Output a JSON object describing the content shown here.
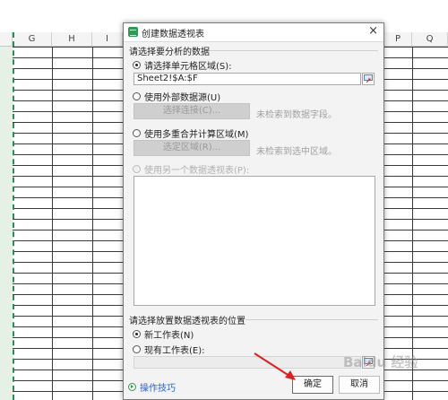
{
  "spreadsheet": {
    "columns": [
      "G",
      "H",
      "I",
      "P",
      "Q"
    ]
  },
  "dialog": {
    "title": "创建数据透视表",
    "close_symbol": "×",
    "section_data_label": "请选择要分析的数据",
    "option_range_label": "请选择单元格区域(S):",
    "range_value": "Sheet2!$A:$F",
    "option_external_label": "使用外部数据源(U)",
    "choose_connection_label": "选择连接(C)...",
    "no_field_hint": "未检索到数据字段。",
    "option_multi_label": "使用多重合并计算区域(M)",
    "choose_region_label": "选定区域(R)...",
    "no_region_hint": "未检索到选中区域。",
    "option_other_pivot_label": "使用另一个数据透视表(P):",
    "section_location_label": "请选择放置数据透视表的位置",
    "option_new_sheet_label": "新工作表(N)",
    "option_existing_sheet_label": "现有工作表(E):",
    "existing_sheet_value": "",
    "tips_label": "操作技巧",
    "ok_label": "确定",
    "cancel_label": "取消"
  },
  "watermark": "Baidu 经验",
  "colors": {
    "accent_green": "#2e9b50",
    "link_blue": "#2a62c9",
    "arrow_red": "#e02020"
  },
  "icons": {
    "app": "pivot-table-app-icon",
    "range_picker": "range-picker-icon",
    "tips": "play-circle-icon"
  }
}
